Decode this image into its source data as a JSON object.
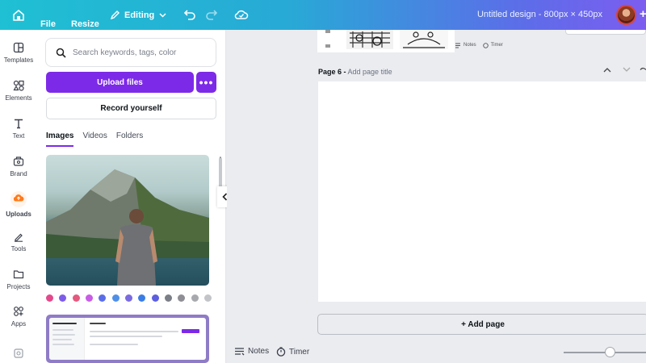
{
  "topbar": {
    "file_label": "File",
    "resize_label": "Resize",
    "mode_label": "Editing",
    "doc_title": "Untitled design - 800px × 450px"
  },
  "rail": {
    "items": [
      {
        "label": "Templates",
        "icon": "templates-icon"
      },
      {
        "label": "Elements",
        "icon": "elements-icon"
      },
      {
        "label": "Text",
        "icon": "text-icon"
      },
      {
        "label": "Brand",
        "icon": "brand-icon"
      },
      {
        "label": "Uploads",
        "icon": "uploads-icon",
        "active": true
      },
      {
        "label": "Tools",
        "icon": "tools-icon"
      },
      {
        "label": "Projects",
        "icon": "projects-icon"
      },
      {
        "label": "Apps",
        "icon": "apps-icon"
      }
    ]
  },
  "panel": {
    "search_placeholder": "Search keywords, tags, color",
    "upload_label": "Upload files",
    "more_label": "•••",
    "record_label": "Record yourself",
    "tabs": [
      {
        "label": "Images",
        "active": true
      },
      {
        "label": "Videos"
      },
      {
        "label": "Folders"
      }
    ]
  },
  "canvas": {
    "prev_notes_label": "Notes",
    "prev_timer_label": "Timer",
    "page_number_label": "Page 6 -",
    "page_title_placeholder": "Add page title",
    "add_page_label": "+ Add page"
  },
  "footer": {
    "notes_label": "Notes",
    "timer_label": "Timer"
  },
  "colors": {
    "accent": "#7d2ae8",
    "uploads_icon": "#ff7a1a"
  }
}
